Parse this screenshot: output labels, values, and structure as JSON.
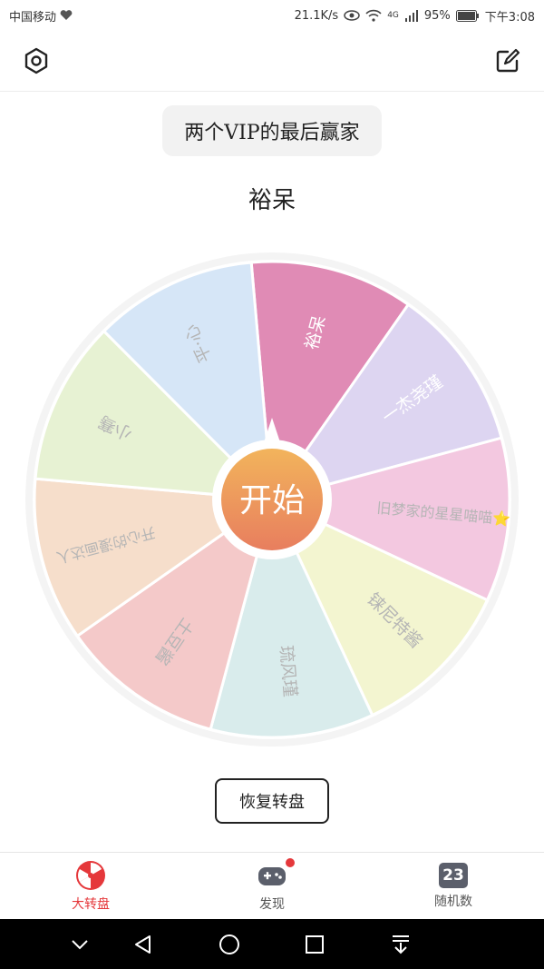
{
  "status": {
    "carrier": "中国移动",
    "speed": "21.1K/s",
    "network": "4G",
    "battery": "95%",
    "time": "下午3:08"
  },
  "header": {
    "settings_icon": "hexagon-settings-icon",
    "edit_icon": "edit-square-icon"
  },
  "title": "两个VIP的最后赢家",
  "result": "裕呆",
  "wheel": {
    "start_label": "开始",
    "segments": [
      {
        "label": "裕呆",
        "color": "#e08bb5",
        "text_color": "#ffffff"
      },
      {
        "label": "一杰尧瑾",
        "color": "#ddd5f1",
        "text_color": "#ffffff"
      },
      {
        "label": "旧梦家的星星喵喵⭐",
        "color": "#f3c8e0",
        "text_color": "#b5b5b5"
      },
      {
        "label": "铼尼特酱",
        "color": "#f3f5d0",
        "text_color": "#b5b5b5"
      },
      {
        "label": "琉风瑾",
        "color": "#d9ecec",
        "text_color": "#b5b5b5"
      },
      {
        "label": "土豆酱",
        "color": "#f4c9c9",
        "text_color": "#b5b5b5"
      },
      {
        "label": "开心的漫画达人",
        "color": "#f6decb",
        "text_color": "#b5b5b5"
      },
      {
        "label": "小骞",
        "color": "#e7f2d3",
        "text_color": "#b5b5b5"
      },
      {
        "label": "平·心",
        "color": "#d6e6f7",
        "text_color": "#b5b5b5"
      }
    ]
  },
  "restore_button": "恢复转盘",
  "nav": {
    "items": [
      {
        "label": "大转盘",
        "active": true
      },
      {
        "label": "发现",
        "active": false
      },
      {
        "label": "随机数",
        "active": false
      }
    ],
    "random_badge": "23",
    "active_color": "#e5383b",
    "inactive_color": "#555555"
  }
}
